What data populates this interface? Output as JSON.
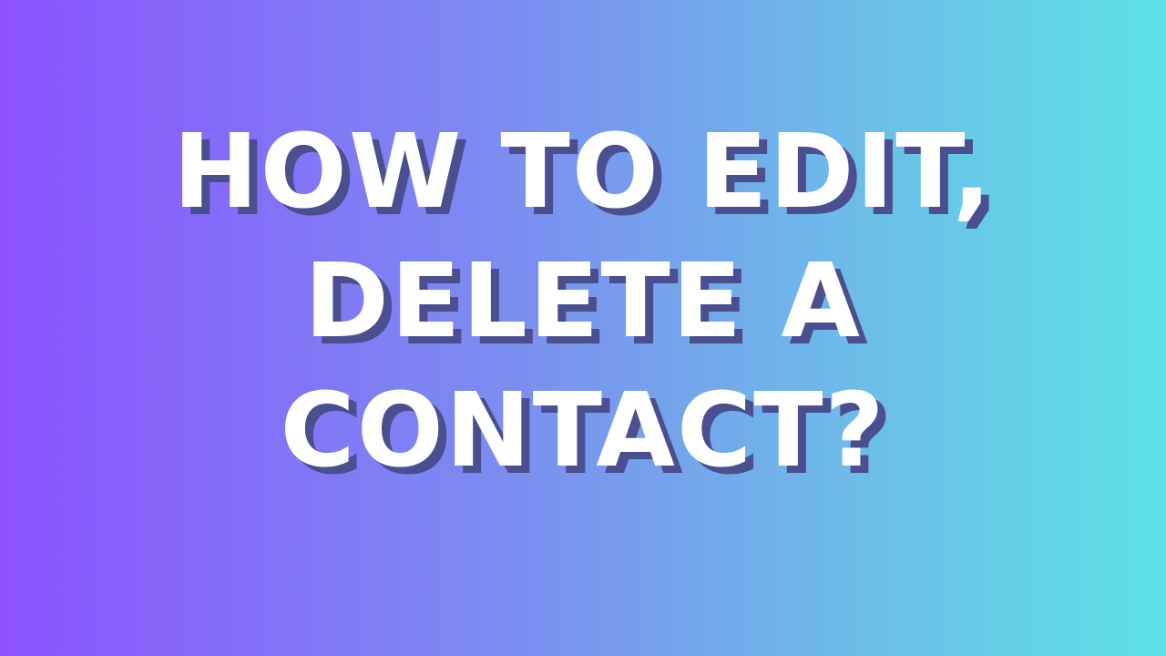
{
  "headline": {
    "lines": [
      "HOW TO EDIT,",
      "DELETE A",
      "CONTACT?"
    ]
  },
  "colors": {
    "gradient_start": "#8c52ff",
    "gradient_end": "#5ce1e6",
    "text": "#ffffff",
    "text_shadow": "#4a4f8f"
  }
}
